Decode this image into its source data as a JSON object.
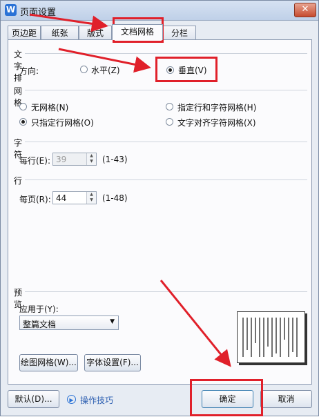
{
  "window": {
    "title": "页面设置",
    "app_icon": "W",
    "close": "✕"
  },
  "tabs": [
    {
      "label": "页边距",
      "active": false
    },
    {
      "label": "纸张",
      "active": false
    },
    {
      "label": "版式",
      "active": false
    },
    {
      "label": "文档网格",
      "active": true
    },
    {
      "label": "分栏",
      "active": false
    }
  ],
  "text_direction": {
    "section": "文字排列",
    "direction_label": "方向:",
    "options": [
      {
        "label": "水平(Z)",
        "selected": false
      },
      {
        "label": "垂直(V)",
        "selected": true
      }
    ]
  },
  "grid": {
    "section": "网格",
    "options": [
      {
        "label": "无网格(N)",
        "selected": false
      },
      {
        "label": "指定行和字符网格(H)",
        "selected": false
      },
      {
        "label": "只指定行网格(O)",
        "selected": true
      },
      {
        "label": "文字对齐字符网格(X)",
        "selected": false
      }
    ]
  },
  "chars": {
    "section": "字符",
    "label": "每行(E):",
    "value": "39",
    "range": "(1-43)"
  },
  "lines": {
    "section": "行",
    "label": "每页(R):",
    "value": "44",
    "range": "(1-48)"
  },
  "preview": {
    "section": "预览",
    "apply_label": "应用于(Y):",
    "apply_value": "整篇文档"
  },
  "buttons": {
    "draw_grid": "绘图网格(W)...",
    "font_settings": "字体设置(F)...",
    "default": "默认(D)...",
    "tips": "操作技巧",
    "ok": "确定",
    "cancel": "取消"
  },
  "colors": {
    "highlight": "#e0202a",
    "arrow": "#e0202a"
  }
}
